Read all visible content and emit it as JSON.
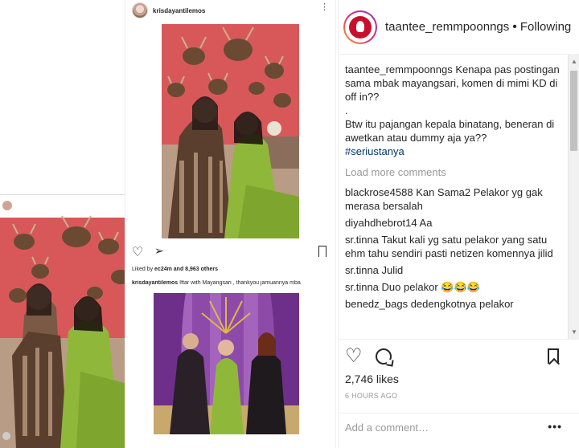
{
  "collage": {
    "post_username": "krisdayantilemos",
    "likes_prefix": "Liked by",
    "likes_user": "ec24m",
    "likes_suffix": "and 8,963 others",
    "caption_user": "krisdayantilemos",
    "caption_text": "Iftar with Mayangsari , thankyou jamuannya mba"
  },
  "header": {
    "username": "taantee_remmpoonngs",
    "separator": "•",
    "follow_label": "Following"
  },
  "caption": {
    "username": "taantee_remmpoonngs",
    "line1": "Kenapa pas postingan sama mbak mayangsari, komen di mimi KD di off in??",
    "line2": ".",
    "line3": "Btw itu pajangan kepala binatang, beneran di awetkan atau dummy aja ya??",
    "hashtag": "#seriustanya"
  },
  "load_more_label": "Load more comments",
  "comments": [
    {
      "user": "blackrose4588",
      "text": "Kan Sama2 Pelakor yg gak merasa bersalah"
    },
    {
      "user": "diyahdhebrot14",
      "text": "Aa"
    },
    {
      "user": "sr.tinna",
      "text": "Takut kali yg satu pelakor yang satu ehm tahu sendiri pasti netizen komennya jilid"
    },
    {
      "user": "sr.tinna",
      "text": "Julid"
    },
    {
      "user": "sr.tinna",
      "text": "Duo pelakor 😂😂😂"
    },
    {
      "user": "benedz_bags",
      "text": "dedengkotnya pelakor"
    }
  ],
  "actions": {
    "likes": "2,746 likes",
    "time": "6 HOURS AGO"
  },
  "add_comment": {
    "placeholder": "Add a comment…",
    "more_label": "•••"
  },
  "icons": {
    "like": "heart-icon",
    "comment": "comment-icon",
    "save": "bookmark-icon",
    "share": "send-icon"
  },
  "colors": {
    "wall_red": "#d8585a",
    "dress_green": "#8fb83a",
    "curtain_purple": "#8e4aa8",
    "hashtag": "#003569",
    "muted": "#999999"
  }
}
